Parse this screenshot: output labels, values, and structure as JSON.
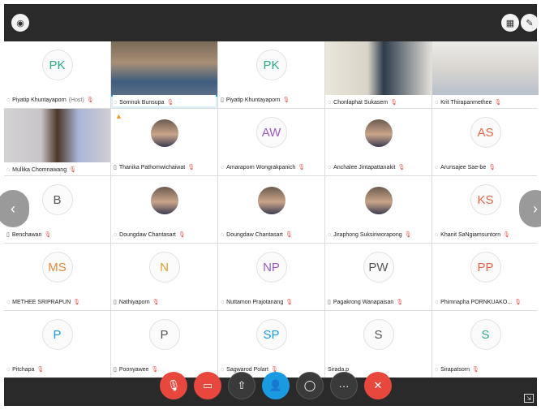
{
  "colors": {
    "accent": "#1a9ae0",
    "end": "#e8473e",
    "bar": "#2a2a2a"
  },
  "participants": [
    {
      "name": "Piyatip Khuntayaporn",
      "suffix": "(Host)",
      "initials": "PK",
      "kind": "initials",
      "initials_color": "#2ea887",
      "device": "mic-icon"
    },
    {
      "name": "Somnuk Bunsupa",
      "kind": "video",
      "active": true,
      "device": "mic-icon"
    },
    {
      "name": "Piyatip Khuntayaporn",
      "initials": "PK",
      "kind": "initials",
      "initials_color": "#2ea887",
      "device": "phone-icon"
    },
    {
      "name": "Chonlaphat Sukasem",
      "kind": "video",
      "device": "mic-icon"
    },
    {
      "name": "Krit Thirapanmethee",
      "kind": "video",
      "device": "mic-icon"
    },
    {
      "name": "Mullika Chomnawang",
      "kind": "video",
      "device": "mic-icon"
    },
    {
      "name": "Thanika Pathomwichaiwat",
      "kind": "photo",
      "warning": true,
      "device": "phone-icon"
    },
    {
      "name": "Amaraporn Wongrakpanich",
      "initials": "AW",
      "kind": "initials",
      "initials_color": "#9a5cc6",
      "device": "mic-icon"
    },
    {
      "name": "Anchalee Jintapattanakit",
      "kind": "photo",
      "device": "mic-icon"
    },
    {
      "name": "Arunsajee Sae-be",
      "initials": "AS",
      "kind": "initials",
      "initials_color": "#e0684a",
      "device": "mic-icon"
    },
    {
      "name": "Benchawan",
      "initials": "B",
      "kind": "initials",
      "initials_color": "#555555",
      "device": "phone-icon"
    },
    {
      "name": "Doungdaw Chantasart",
      "kind": "photo",
      "device": "mic-icon"
    },
    {
      "name": "Doungdaw Chantasart",
      "kind": "photo",
      "device": "mic-icon"
    },
    {
      "name": "Jiraphong Suksiriworapong",
      "kind": "photo",
      "device": "mic-icon"
    },
    {
      "name": "Khanit SaNgiamsuntorn",
      "initials": "KS",
      "kind": "initials",
      "initials_color": "#e0684a",
      "device": "mic-icon"
    },
    {
      "name": "METHEE SRIPRAPUN",
      "initials": "MS",
      "kind": "initials",
      "initials_color": "#e08a3a",
      "device": "mic-icon"
    },
    {
      "name": "Nathiyaporn",
      "initials": "N",
      "kind": "initials",
      "initials_color": "#e0a030",
      "device": "phone-icon"
    },
    {
      "name": "Nuttamon Prajotanang",
      "initials": "NP",
      "kind": "initials",
      "initials_color": "#9a5cc6",
      "device": "mic-icon"
    },
    {
      "name": "Pagakrong Wanapaisan",
      "initials": "PW",
      "kind": "initials",
      "initials_color": "#555555",
      "device": "phone-icon"
    },
    {
      "name": "Phimnapha PORNKUAKO...",
      "initials": "PP",
      "kind": "initials",
      "initials_color": "#e0684a",
      "device": "mic-icon"
    },
    {
      "name": "Pitchapa",
      "initials": "P",
      "kind": "initials",
      "initials_color": "#1a9ae0",
      "device": "mic-icon"
    },
    {
      "name": "Poonyawee",
      "initials": "P",
      "kind": "initials",
      "initials_color": "#555555",
      "device": "phone-icon"
    },
    {
      "name": "Sagwarod Polart",
      "initials": "SP",
      "kind": "initials",
      "initials_color": "#1a9ae0",
      "device": "mic-icon"
    },
    {
      "name": "Sirada.p",
      "initials": "S",
      "kind": "initials",
      "initials_color": "#555555",
      "device": "none"
    },
    {
      "name": "Sirapatsorn",
      "initials": "S",
      "kind": "initials",
      "initials_color": "#2ea887",
      "device": "mic-icon"
    }
  ],
  "controls": [
    {
      "name": "mute-button",
      "icon": "mic-off-icon",
      "glyph": "🎙",
      "style": "red"
    },
    {
      "name": "video-button",
      "icon": "video-off-icon",
      "glyph": "▭",
      "style": "red"
    },
    {
      "name": "share-button",
      "icon": "share-icon",
      "glyph": "⇧",
      "style": "gray"
    },
    {
      "name": "participants-button",
      "icon": "person-icon",
      "glyph": "👤",
      "style": "blue"
    },
    {
      "name": "chat-button",
      "icon": "chat-icon",
      "glyph": "◯",
      "style": "gray"
    },
    {
      "name": "more-button",
      "icon": "more-icon",
      "glyph": "···",
      "style": "gray"
    },
    {
      "name": "leave-button",
      "icon": "close-icon",
      "glyph": "✕",
      "style": "red"
    }
  ]
}
